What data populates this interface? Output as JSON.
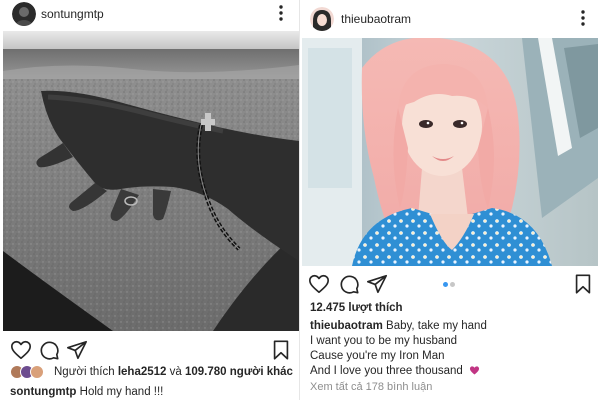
{
  "left_post": {
    "username": "sontungmtp",
    "liked_by_prefix": "Người thích",
    "liked_by_user": "leha2512",
    "liked_by_and": "và",
    "liked_by_others": "109.780 người khác",
    "caption_user": "sontungmtp",
    "caption_text": "Hold my hand !!!"
  },
  "right_post": {
    "username": "thieubaotram",
    "likes": "12.475 lượt thích",
    "caption_user": "thieubaotram",
    "caption_lines": [
      "Baby, take my hand",
      "I want you to be my husband",
      "Cause you're my Iron Man",
      "And I love you three thousand"
    ],
    "view_comments": "Xem tất cả 178 bình luận",
    "carousel": {
      "count": 2,
      "active": 0
    }
  },
  "icons": {
    "more": "more-vertical-icon",
    "like": "heart-icon",
    "comment": "comment-icon",
    "share": "send-icon",
    "save": "bookmark-icon",
    "caption_emoji": "purple-heart-icon"
  },
  "colors": {
    "text": "#262626",
    "muted": "#8e8e8e",
    "carousel_active": "#3897f0",
    "carousel_inactive": "#c7c7c7",
    "heart_emoji": "#c13584"
  }
}
